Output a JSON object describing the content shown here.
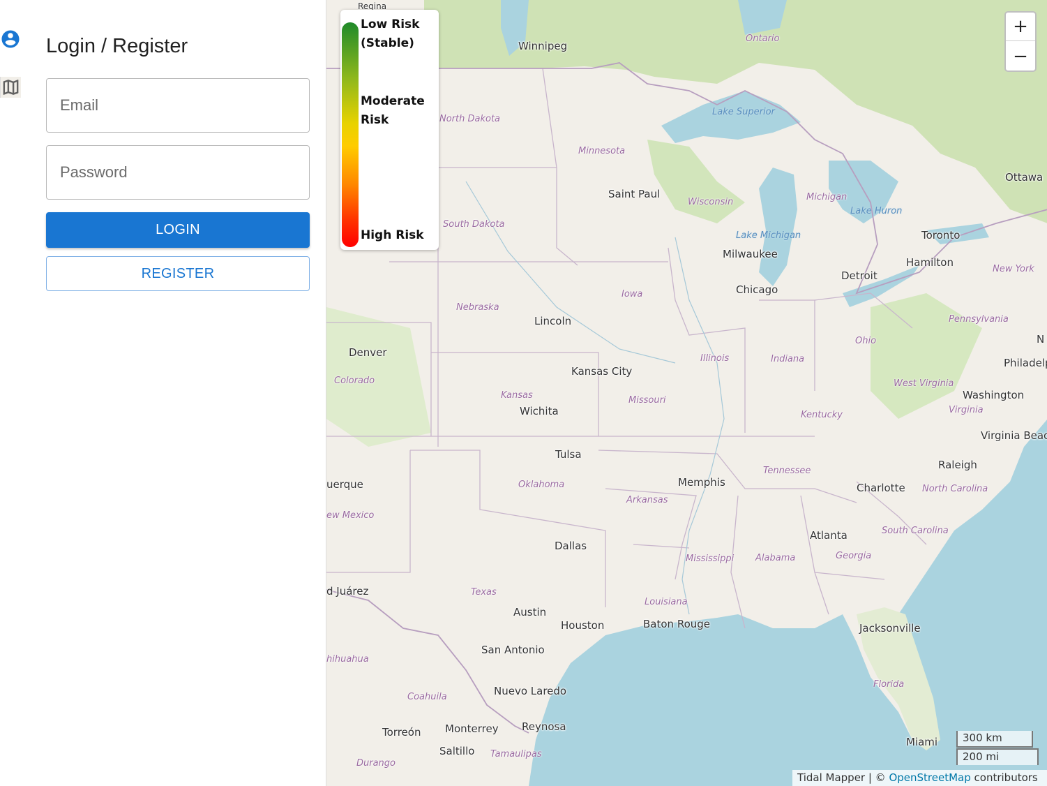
{
  "rail": {
    "icons": [
      "account-circle-icon",
      "map-icon"
    ],
    "colors": {
      "account": "#1976d2",
      "map": "#616161"
    }
  },
  "auth": {
    "title": "Login / Register",
    "email_placeholder": "Email",
    "email_value": "",
    "password_placeholder": "Password",
    "password_value": "",
    "login_label": "LOGIN",
    "register_label": "REGISTER",
    "primary_color": "#1976d2"
  },
  "legend": {
    "low": "Low Risk (Stable)",
    "moderate": "Moderate Risk",
    "high": "High Risk",
    "gradient_colors": [
      "#1f8a2a",
      "#e8d200",
      "#ff0000"
    ]
  },
  "map": {
    "cities": [
      "Winnipeg",
      "Ottawa",
      "Saint Paul",
      "Toronto",
      "Milwaukee",
      "Hamilton",
      "Detroit",
      "Chicago",
      "Lincoln",
      "Denver",
      "Philadelp",
      "Kansas City",
      "Washington",
      "Wichita",
      "Virginia Beac",
      "Tulsa",
      "Raleigh",
      "uerque",
      "Memphis",
      "Charlotte",
      "Atlanta",
      "Dallas",
      "d Juárez",
      "Austin",
      "Houston",
      "Baton Rouge",
      "Jacksonville",
      "San Antonio",
      "Nuevo Laredo",
      "Reynosa",
      "Monterrey",
      "Torreón",
      "Saltillo",
      "Miami",
      "Regina",
      "N"
    ],
    "states": [
      "Ontario",
      "North Dakota",
      "Minnesota",
      "Wisconsin",
      "Michigan",
      "South Dakota",
      "Iowa",
      "Nebraska",
      "Illinois",
      "Indiana",
      "Ohio",
      "Pennsylvania",
      "New York",
      "Colorado",
      "Kansas",
      "Missouri",
      "West Virginia",
      "Virginia",
      "Kentucky",
      "Tennessee",
      "North Carolina",
      "Oklahoma",
      "Arkansas",
      "ew Mexico",
      "Mississippi",
      "Alabama",
      "Georgia",
      "South Carolina",
      "Texas",
      "Louisiana",
      "Florida",
      "hihuahua",
      "Coahuila",
      "Tamaulipas",
      "Durango"
    ],
    "waters": [
      "Lake Superior",
      "Lake Michigan",
      "Lake Huron"
    ],
    "zoom_in": "+",
    "zoom_out": "−",
    "scale_km": "300 km",
    "scale_mi": "200 mi",
    "attribution_prefix": "Tidal Mapper | © ",
    "attribution_link": "OpenStreetMap",
    "attribution_suffix": " contributors",
    "colors": {
      "land": "#f2efe9",
      "water": "#aad3df",
      "forest": "#c8dfae",
      "border": "#b79ebf"
    }
  }
}
